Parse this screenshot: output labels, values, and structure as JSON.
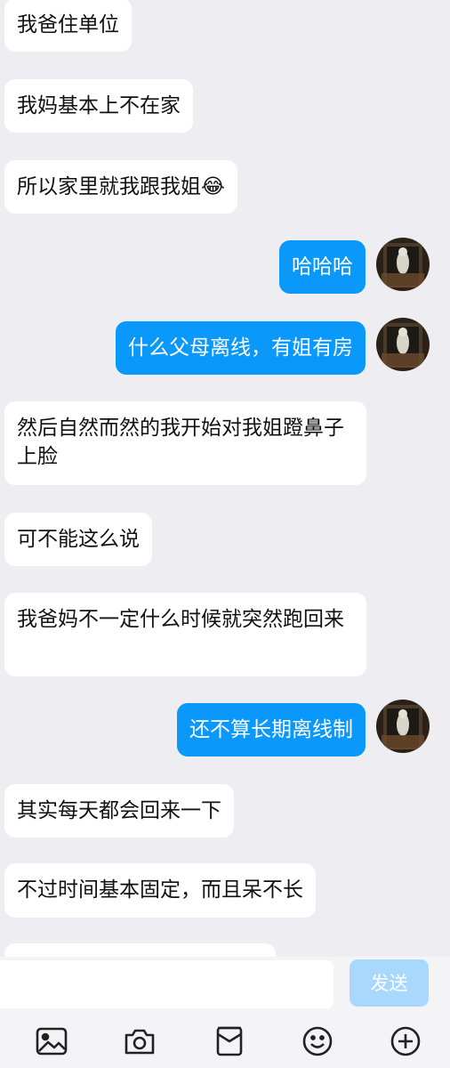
{
  "messages": [
    {
      "side": "left",
      "text": "我爸住单位"
    },
    {
      "side": "left",
      "text": "我妈基本上不在家"
    },
    {
      "side": "left",
      "text": "所以家里就我跟我姐😂"
    },
    {
      "side": "right",
      "text": "哈哈哈"
    },
    {
      "side": "right",
      "text": "什么父母离线，有姐有房"
    },
    {
      "side": "left",
      "text": "然后自然而然的我开始对我姐蹬鼻子上脸"
    },
    {
      "side": "left",
      "text": "可不能这么说"
    },
    {
      "side": "left",
      "text": "我爸妈不一定什么时候就突然跑回来"
    },
    {
      "side": "right",
      "text": "还不算长期离线制"
    },
    {
      "side": "left",
      "text": "其实每天都会回来一下"
    },
    {
      "side": "left",
      "text": "不过时间基本固定，而且呆不长"
    }
  ],
  "input": {
    "value": "",
    "send_label": "发送"
  },
  "toolbar": {
    "icons": [
      "image-icon",
      "camera-icon",
      "voucher-icon",
      "emoji-icon",
      "plus-icon"
    ]
  },
  "colors": {
    "background": "#ededf2",
    "outgoing": "#0a98fb",
    "incoming": "#ffffff",
    "send_disabled": "#a9d8ff"
  }
}
